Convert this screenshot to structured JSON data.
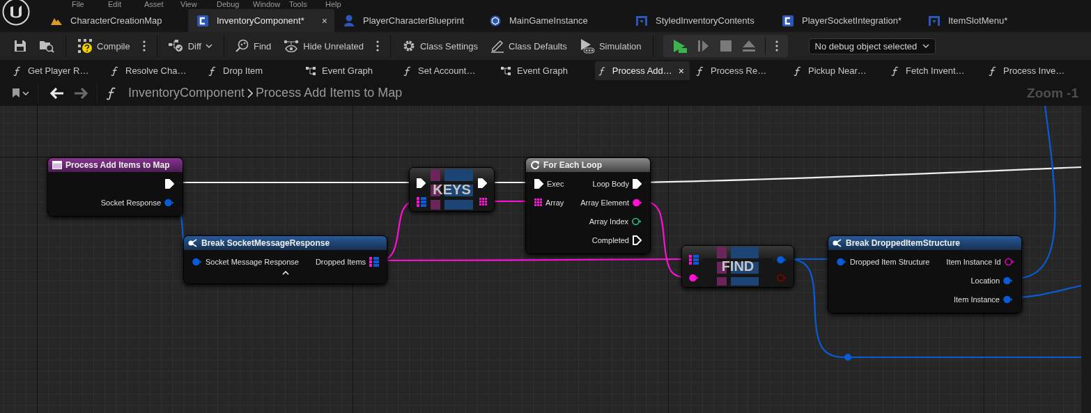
{
  "menu": [
    {
      "label": "File"
    },
    {
      "label": "Edit"
    },
    {
      "label": "Asset"
    },
    {
      "label": "View"
    },
    {
      "label": "Debug"
    },
    {
      "label": "Window"
    },
    {
      "label": "Tools"
    },
    {
      "label": "Help"
    }
  ],
  "doc_tabs": [
    {
      "kind": "level",
      "label": "CharacterCreationMap",
      "selected": false
    },
    {
      "kind": "class",
      "label": "InventoryComponent*",
      "selected": true,
      "close": "×"
    },
    {
      "kind": "character",
      "label": "PlayerCharacterBlueprint",
      "selected": false
    },
    {
      "kind": "game-instance",
      "label": "MainGameInstance",
      "selected": false
    },
    {
      "kind": "widget",
      "label": "StyledInventoryContents",
      "selected": false
    },
    {
      "kind": "class",
      "label": "PlayerSocketIntegration*",
      "selected": false
    },
    {
      "kind": "widget",
      "label": "ItemSlotMenu*",
      "selected": false
    }
  ],
  "toolbar": [
    [
      {
        "kind": "save"
      },
      {
        "kind": "browse"
      }
    ],
    [
      {
        "kind": "compile",
        "label": "Compile"
      },
      {
        "kind": "options"
      }
    ],
    [
      {
        "kind": "diff",
        "label": "Diff"
      }
    ],
    [
      {
        "kind": "find",
        "label": "Find"
      },
      {
        "kind": "hide-unrelated",
        "label": "Hide Unrelated"
      },
      {
        "kind": "options"
      }
    ],
    [
      {
        "kind": "class-settings",
        "label": "Class Settings"
      },
      {
        "kind": "class-defaults",
        "label": "Class Defaults"
      },
      {
        "kind": "simulation",
        "label": "Simulation"
      }
    ],
    [
      {
        "kind": "play"
      },
      {
        "kind": "step"
      },
      {
        "kind": "stop"
      },
      {
        "kind": "eject"
      },
      {
        "kind": "options"
      }
    ]
  ],
  "debug_filter": {
    "value": "No debug object selected"
  },
  "graph_tabs": [
    {
      "kind": "function",
      "label": "Get Player R…",
      "selected": false
    },
    {
      "kind": "function",
      "label": "Resolve Cha…",
      "selected": false
    },
    {
      "kind": "function",
      "label": "Drop Item",
      "selected": false
    },
    {
      "kind": "graph",
      "label": "Event Graph",
      "selected": false
    },
    {
      "kind": "function",
      "label": "Set Account…",
      "selected": false
    },
    {
      "kind": "graph",
      "label": "Event Graph",
      "selected": false
    },
    {
      "kind": "function",
      "label": "Process Add…",
      "selected": true,
      "close": "×"
    },
    {
      "kind": "function",
      "label": "Process Re…",
      "selected": false
    },
    {
      "kind": "function",
      "label": "Pickup Near…",
      "selected": false
    },
    {
      "kind": "function",
      "label": "Fetch Invent…",
      "selected": false
    },
    {
      "kind": "function",
      "label": "Process Inve…",
      "selected": false
    }
  ],
  "breadcrumb": {
    "nav": [
      {
        "kind": "back",
        "disabled": false
      },
      {
        "kind": "forward",
        "disabled": true
      }
    ],
    "path": [
      "InventoryComponent",
      "Process Add Items to Map"
    ],
    "zoom": "Zoom -1"
  },
  "nodes": [
    {
      "kind": "function-entry",
      "title": "Process Add Items to Map",
      "rows": [
        {
          "out": {
            "kind": "exec",
            "connected": true,
            "color": "#ffffff"
          }
        },
        {
          "out": {
            "label": "Socket Response",
            "kind": "value",
            "connected": true,
            "color": "#0a5bd8"
          }
        }
      ]
    },
    {
      "kind": "compact",
      "title": "KEYS",
      "rows": [
        {
          "in": {
            "kind": "exec",
            "connected": true,
            "color": "#ffffff"
          },
          "out": {
            "kind": "exec",
            "connected": true,
            "color": "#ffffff"
          }
        },
        {
          "in": {
            "kind": "map",
            "connected": true,
            "color": "#ff10d8"
          },
          "out": {
            "kind": "array",
            "connected": true,
            "color": "#ff10d8"
          }
        }
      ]
    },
    {
      "kind": "macro",
      "title": "For Each Loop",
      "rows": [
        {
          "in": {
            "label": "Exec",
            "kind": "exec",
            "connected": true,
            "color": "#ffffff"
          },
          "out": {
            "label": "Loop Body",
            "kind": "exec",
            "connected": true,
            "color": "#ffffff"
          }
        },
        {
          "in": {
            "label": "Array",
            "kind": "array",
            "connected": true,
            "color": "#ff10d8"
          },
          "out": {
            "label": "Array Element",
            "kind": "value",
            "connected": true,
            "color": "#ff10d8"
          }
        },
        {
          "out": {
            "label": "Array Index",
            "kind": "value",
            "connected": false,
            "color": "#1fc39a"
          }
        },
        {
          "out": {
            "label": "Completed",
            "kind": "exec",
            "connected": false,
            "color": "#ffffff"
          }
        }
      ]
    },
    {
      "kind": "break",
      "title": "Break SocketMessageResponse",
      "advanced_toggle": true,
      "rows": [
        {
          "in": {
            "label": "Socket Message Response",
            "kind": "value",
            "connected": true,
            "color": "#0a5bd8"
          },
          "out": {
            "label": "Dropped Items",
            "kind": "map",
            "connected": true,
            "color": "#ff10d8"
          }
        }
      ]
    },
    {
      "kind": "compact",
      "title": "FIND",
      "rows": [
        {
          "in": {
            "kind": "map",
            "connected": true,
            "color": "#ff10d8"
          },
          "out": {
            "kind": "value",
            "connected": true,
            "color": "#0a5bd8"
          }
        },
        {
          "in": {
            "kind": "value",
            "connected": true,
            "color": "#ff10d8"
          },
          "out": {
            "kind": "value",
            "connected": false,
            "color": "#8a0000"
          }
        }
      ]
    },
    {
      "kind": "break",
      "title": "Break DroppedItemStructure",
      "advanced_toggle": false,
      "rows": [
        {
          "in": {
            "label": "Dropped Item Structure",
            "kind": "value",
            "connected": true,
            "color": "#0a5bd8"
          },
          "out": {
            "label": "Item Instance Id",
            "kind": "value",
            "connected": false,
            "color": "#e000c0"
          }
        },
        {
          "out": {
            "label": "Location",
            "kind": "value",
            "connected": true,
            "color": "#0a5bd8"
          }
        },
        {
          "out": {
            "label": "Item Instance",
            "kind": "value",
            "connected": true,
            "color": "#0a5bd8"
          }
        }
      ]
    }
  ]
}
